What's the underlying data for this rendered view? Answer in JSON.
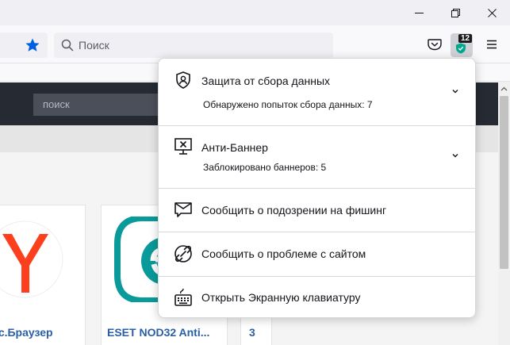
{
  "browser": {
    "search_placeholder": "Поиск",
    "extension_badge": "12"
  },
  "page": {
    "search_placeholder": "поиск",
    "cards": [
      {
        "title": "кс.Браузер"
      },
      {
        "title": "ESET NOD32 Anti..."
      },
      {
        "title": "3"
      }
    ]
  },
  "popup": {
    "items": [
      {
        "label": "Защита от сбора данных",
        "sublabel": "Обнаружено попыток сбора данных: 7",
        "icon": "shield-user-icon"
      },
      {
        "label": "Анти-Баннер",
        "sublabel": "Заблокировано баннеров: 5",
        "icon": "banner-block-icon"
      },
      {
        "label": "Сообщить о подозрении на фишинг",
        "icon": "envelope-icon"
      },
      {
        "label": "Сообщить о проблеме с сайтом",
        "icon": "broken-link-icon"
      },
      {
        "label": "Открыть Экранную клавиатуру",
        "icon": "keyboard-icon"
      }
    ]
  },
  "colors": {
    "accent_blue": "#0061e0",
    "extension_green": "#00a88e",
    "card_title": "#2a5fa5",
    "yandex_red": "#fc3f1d",
    "eset_teal": "#0a9a9a"
  }
}
